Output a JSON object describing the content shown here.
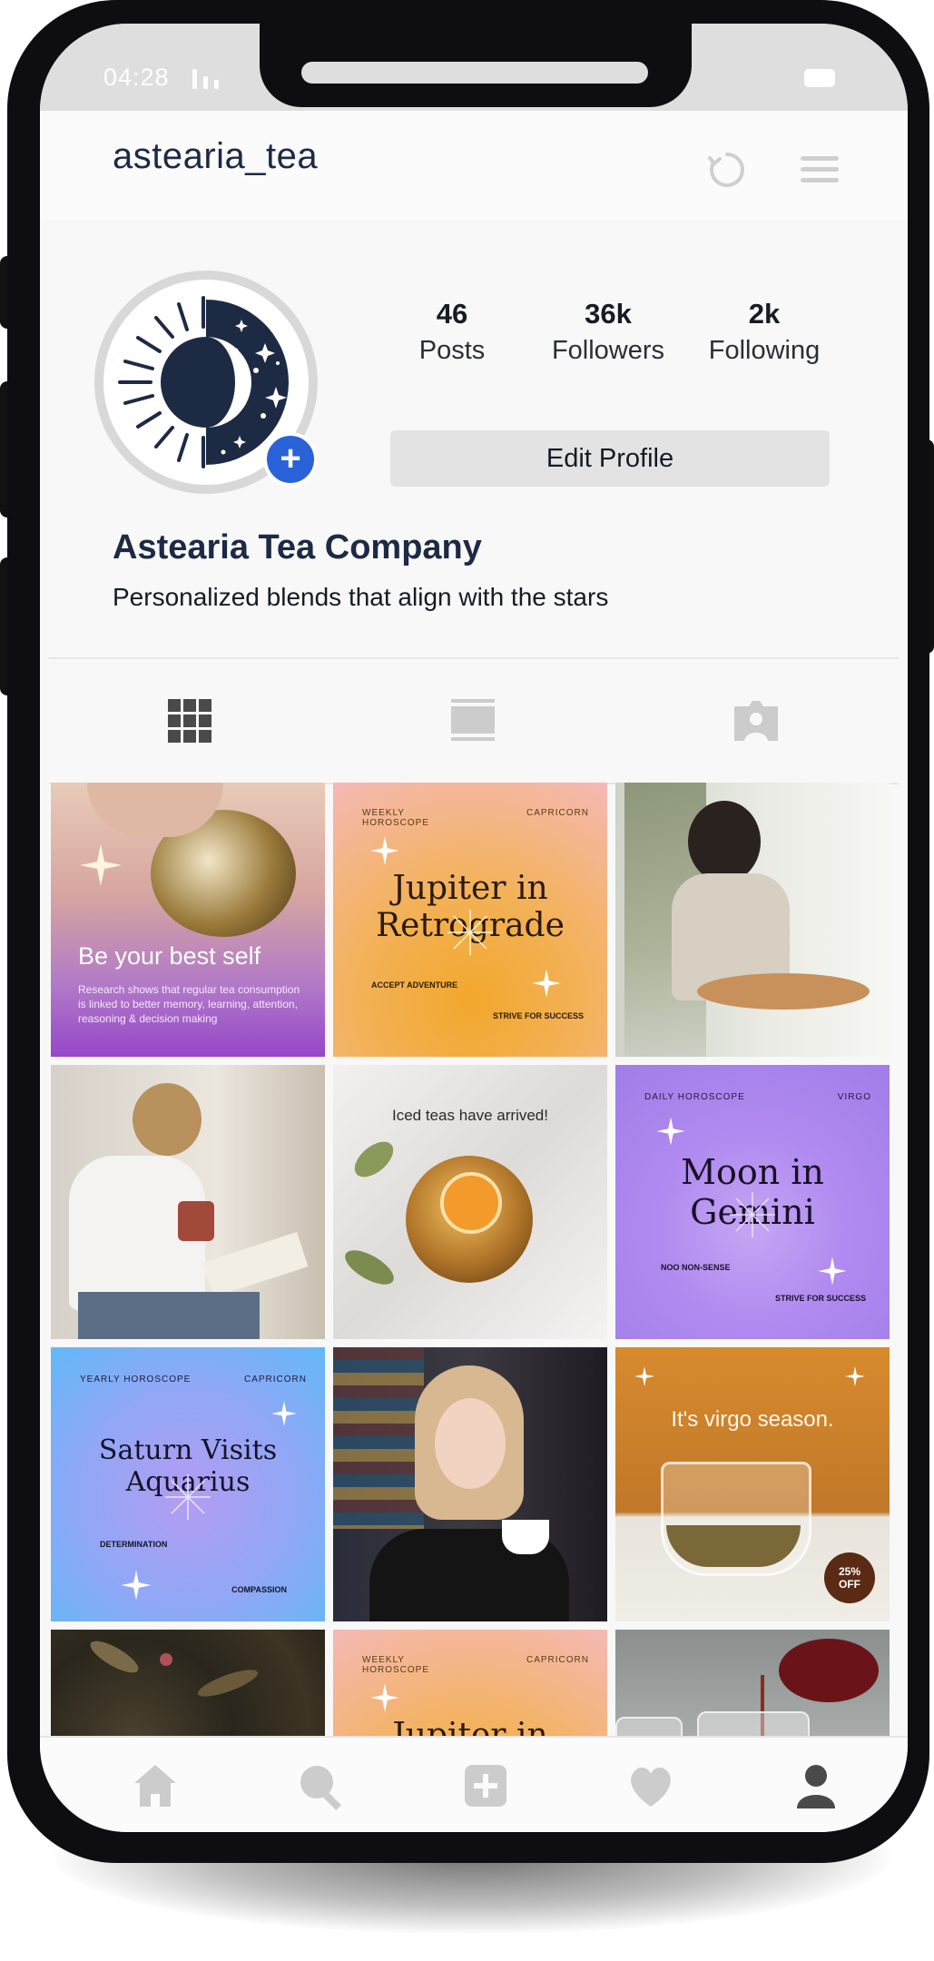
{
  "status_bar": {
    "time": "04:28",
    "signal_icon": "signal-icon",
    "battery_icon": "battery-icon"
  },
  "header": {
    "username": "astearia_tea",
    "refresh_icon": "refresh-icon",
    "menu_icon": "hamburger-menu-icon"
  },
  "profile": {
    "stats": [
      {
        "value": "46",
        "label": "Posts"
      },
      {
        "value": "36k",
        "label": "Followers"
      },
      {
        "value": "2k",
        "label": "Following"
      }
    ],
    "edit_button": "Edit Profile",
    "name": "Astearia Tea Company",
    "bio": "Personalized blends that align with the stars",
    "add_badge": "+"
  },
  "tabs": [
    {
      "icon": "grid-icon",
      "active": true
    },
    {
      "icon": "feed-icon",
      "active": false
    },
    {
      "icon": "tagged-icon",
      "active": false
    }
  ],
  "posts": {
    "p1": {
      "title": "Be your best self",
      "body": "Research shows that regular tea consumption is linked to better memory, learning, attention, reasoning & decision making"
    },
    "p2": {
      "top_left": "WEEKLY HOROSCOPE",
      "top_right": "CAPRICORN",
      "headline": "Jupiter in Retrograde",
      "left": "ACCEPT ADVENTURE",
      "right": "STRIVE FOR SUCCESS"
    },
    "p5": {
      "caption": "Iced teas have arrived!"
    },
    "p6": {
      "top_left": "DAILY HOROSCOPE",
      "top_right": "VIRGO",
      "headline": "Moon in Gemini",
      "left": "NOO NON-SENSE",
      "right": "STRIVE FOR SUCCESS"
    },
    "p7": {
      "top_left": "YEARLY HOROSCOPE",
      "top_right": "CAPRICORN",
      "headline": "Saturn Visits Aquarius",
      "left": "DETERMINATION",
      "right": "COMPASSION"
    },
    "p9": {
      "caption": "It's virgo season.",
      "badge_line1": "25%",
      "badge_line2": "OFF"
    },
    "p11": {
      "top_left": "WEEKLY HOROSCOPE",
      "top_right": "CAPRICORN",
      "headline": "Jupiter in Retrograde"
    }
  },
  "bottom_nav": [
    {
      "icon": "home-icon"
    },
    {
      "icon": "search-icon"
    },
    {
      "icon": "add-post-icon"
    },
    {
      "icon": "heart-icon"
    },
    {
      "icon": "profile-icon",
      "active": true
    }
  ],
  "colors": {
    "accent_blue": "#2a62d8",
    "navy": "#1d2a44",
    "nav_inactive": "#cccccc",
    "nav_active": "#4a4a4a"
  }
}
